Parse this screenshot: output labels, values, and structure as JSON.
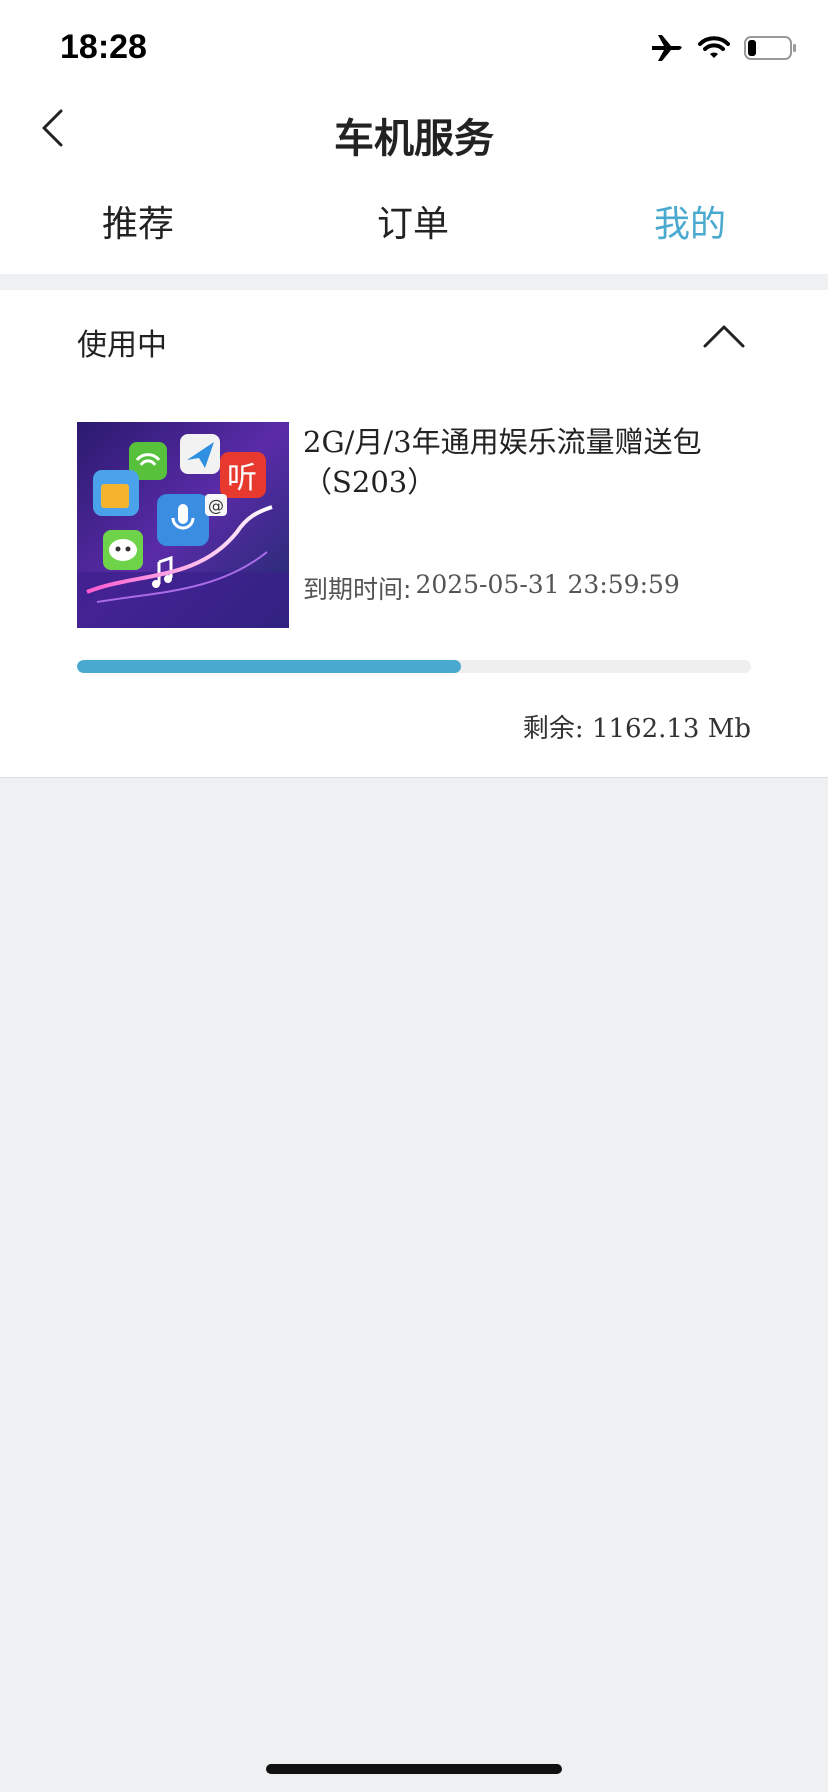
{
  "status_bar": {
    "time": "18:28",
    "icons": [
      "airplane-icon",
      "wifi-icon",
      "battery-icon"
    ],
    "battery_level": 0.2
  },
  "nav": {
    "title": "车机服务",
    "back_icon": "chevron-left-icon"
  },
  "tabs": [
    {
      "label": "推荐",
      "active": false
    },
    {
      "label": "订单",
      "active": false
    },
    {
      "label": "我的",
      "active": true
    }
  ],
  "colors": {
    "accent": "#4aa9cf",
    "background": "#eef0f2",
    "text": "#222222"
  },
  "section": {
    "title": "使用中",
    "collapse_icon": "chevron-up-icon"
  },
  "package": {
    "name": "2G/月/3年通用娱乐流量赠送包（S203）",
    "expiry_label": "到期时间:",
    "expiry_value": "2025-05-31 23:59:59",
    "remaining_text": "剩余: 1162.13 Mb",
    "usage_fraction": 0.57,
    "thumbnail": "app-collage-image"
  }
}
